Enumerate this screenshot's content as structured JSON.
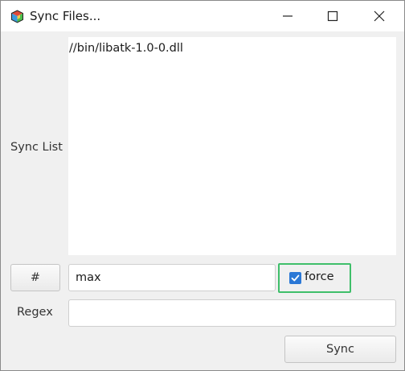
{
  "window": {
    "title": "Sync Files...",
    "icons": {
      "app": "colored-cube-icon",
      "minimize": "minimize-icon",
      "maximize": "maximize-icon",
      "close": "close-icon"
    }
  },
  "form": {
    "sync_list_label": "Sync List",
    "sync_list_items": [
      "//bin/libatk-1.0-0.dll"
    ],
    "hash_button_label": "#",
    "max_field_value": "max",
    "force_checkbox": {
      "label": "force",
      "checked": true
    },
    "regex_label": "Regex",
    "regex_field_value": "",
    "sync_button_label": "Sync"
  },
  "colors": {
    "checkbox_accent": "#2b78d6",
    "highlight_border": "#3fbf6a"
  }
}
